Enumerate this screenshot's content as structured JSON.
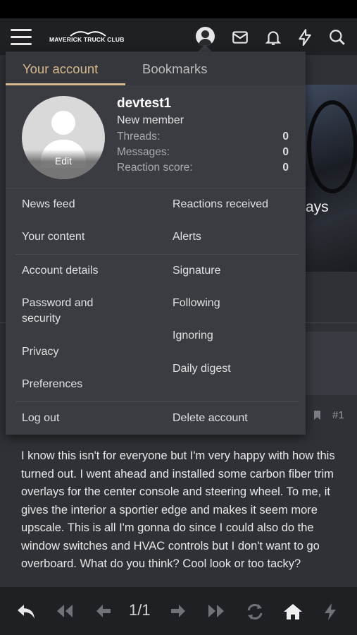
{
  "header": {
    "logo_text": "MAVERICK TRUCK CLUB",
    "menu_icon": "hamburger-icon",
    "icons": [
      "user-avatar-icon",
      "mail-icon",
      "bell-icon",
      "lightning-icon",
      "search-icon"
    ]
  },
  "account_menu": {
    "tabs": [
      "Your account",
      "Bookmarks"
    ],
    "active_tab": "Your account",
    "avatar_edit_label": "Edit",
    "username": "devtest1",
    "role": "New member",
    "stats": [
      {
        "label": "Threads:",
        "value": "0"
      },
      {
        "label": "Messages:",
        "value": "0"
      },
      {
        "label": "Reaction score:",
        "value": "0"
      }
    ],
    "links_left": [
      "News feed",
      "Your content",
      "Account details",
      "Password and security",
      "Privacy",
      "Preferences"
    ],
    "links_right": [
      "Reactions received",
      "Alerts",
      "Signature",
      "Following",
      "Ignoring",
      "Daily digest"
    ],
    "logout_label": "Log out",
    "delete_label": "Delete account"
  },
  "background": {
    "image_overlay_text": "ays",
    "post_number": "#1",
    "post_text": "I know this isn't for everyone but I'm very happy with how this turned out. I went ahead and installed some carbon fiber trim overlays for the center console and steering wheel. To me, it gives the interior a sportier edge and makes it seem more upscale. This is all I'm gonna do since I could also do the window switches and HVAC controls but I don't want to go overboard. What do you think? Cool look or too tacky?"
  },
  "bottom_nav": {
    "page_indicator": "1/1",
    "icons": [
      "reply-icon",
      "first-page-icon",
      "prev-page-icon",
      "next-page-icon",
      "last-page-icon",
      "refresh-icon",
      "home-icon",
      "lightning-icon"
    ]
  },
  "colors": {
    "accent": "#d6b98c",
    "menu_bg": "#3a3c42",
    "page_bg": "#2f3136",
    "bar_bg": "#1f2023"
  }
}
